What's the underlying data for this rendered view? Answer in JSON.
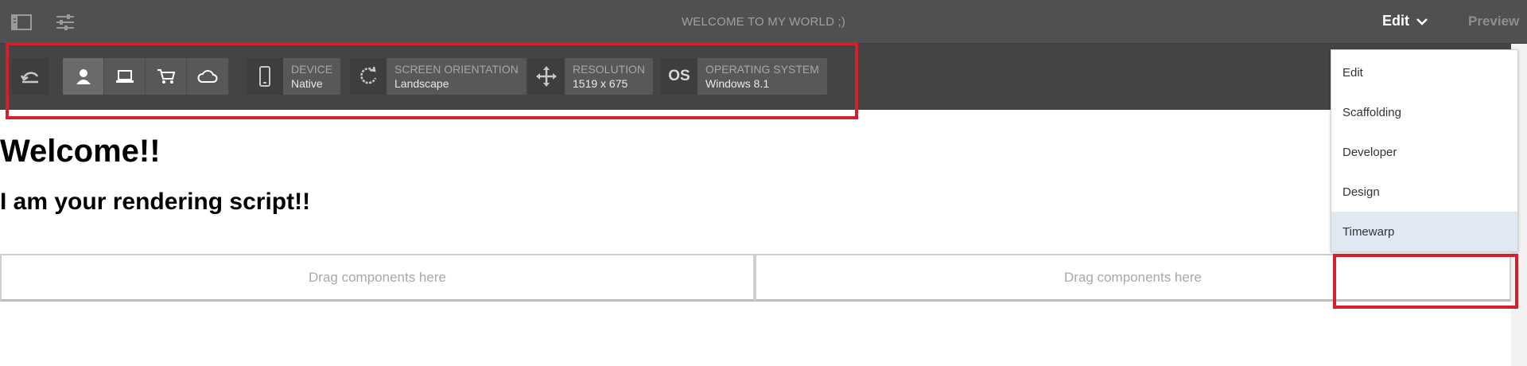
{
  "header": {
    "title": "WELCOME TO MY WORLD ;)",
    "mode_label": "Edit",
    "preview_label": "Preview"
  },
  "toolbar": {
    "device": {
      "label": "DEVICE",
      "value": "Native"
    },
    "orientation": {
      "label": "SCREEN ORIENTATION",
      "value": "Landscape"
    },
    "resolution": {
      "label": "RESOLUTION",
      "value": "1519 x 675"
    },
    "os": {
      "icon_text": "OS",
      "label": "OPERATING SYSTEM",
      "value": "Windows 8.1"
    }
  },
  "page": {
    "heading": "Welcome!!",
    "subheading": "I am your rendering script!!",
    "dropzone_left": "Drag components here",
    "dropzone_right": "Drag components here"
  },
  "mode_menu": {
    "items": [
      "Edit",
      "Scaffolding",
      "Developer",
      "Design",
      "Timewarp"
    ],
    "selected": "Timewarp"
  },
  "colors": {
    "highlight": "#d3202e",
    "topbar": "#505050",
    "toolbar": "#444444",
    "selected_item": "#dfe8f3"
  }
}
